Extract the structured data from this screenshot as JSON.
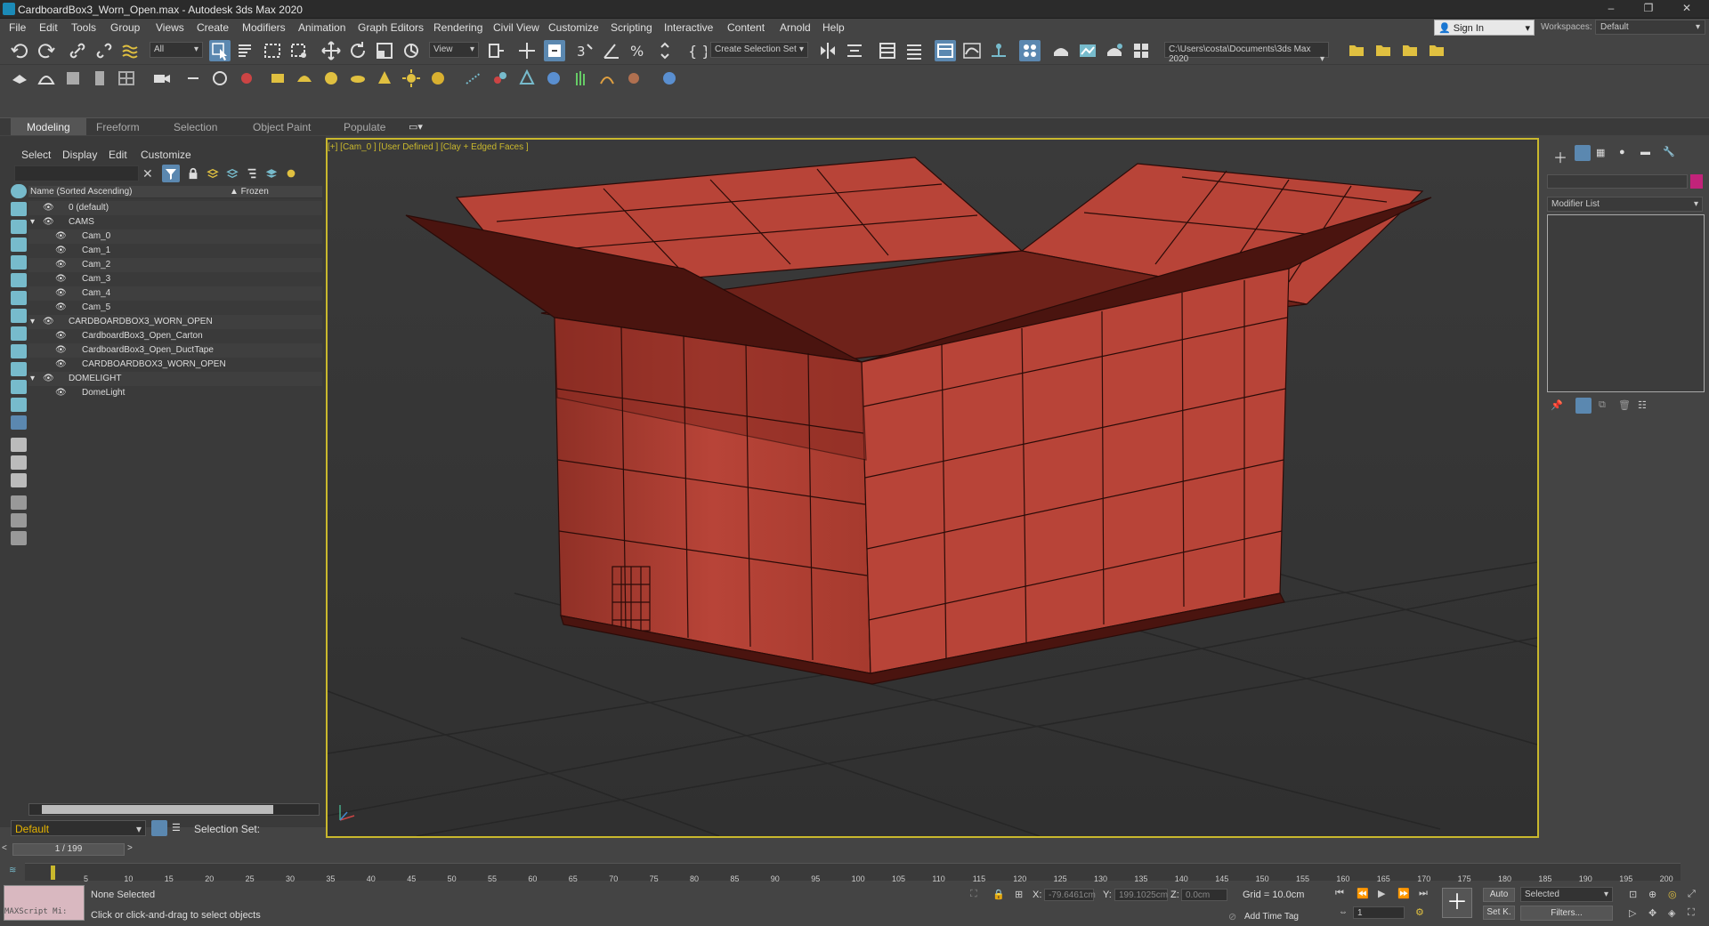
{
  "window": {
    "title": "CardboardBox3_Worn_Open.max - Autodesk 3ds Max 2020",
    "controls": {
      "minimize": "–",
      "maximize": "❐",
      "close": "✕"
    }
  },
  "menu": [
    "File",
    "Edit",
    "Tools",
    "Group",
    "Views",
    "Create",
    "Modifiers",
    "Animation",
    "Graph Editors",
    "Rendering",
    "Civil View",
    "Customize",
    "Scripting",
    "Interactive",
    "Content",
    "Arnold",
    "Help"
  ],
  "account": {
    "sign_in": "Sign In",
    "workspaces_label": "Workspaces:",
    "workspace": "Default"
  },
  "toolbar": {
    "selection_filter": "All",
    "ref_coord": "View",
    "create_selection_set": "Create Selection Set",
    "project_path": "C:\\Users\\costa\\Documents\\3ds Max 2020"
  },
  "ribbon_tabs": [
    "Modeling",
    "Freeform",
    "Selection",
    "Object Paint",
    "Populate"
  ],
  "scene_explorer": {
    "menus": [
      "Select",
      "Display",
      "Edit",
      "Customize"
    ],
    "col_name": "Name (Sorted Ascending)",
    "col_frozen": "▲ Frozen",
    "rows": [
      {
        "label": "0 (default)"
      },
      {
        "label": "CAMS"
      },
      {
        "label": "Cam_0"
      },
      {
        "label": "Cam_1"
      },
      {
        "label": "Cam_2"
      },
      {
        "label": "Cam_3"
      },
      {
        "label": "Cam_4"
      },
      {
        "label": "Cam_5"
      },
      {
        "label": "CARDBOARDBOX3_WORN_OPEN"
      },
      {
        "label": "CardboardBox3_Open_Carton"
      },
      {
        "label": "CardboardBox3_Open_DuctTape"
      },
      {
        "label": "CARDBOARDBOX3_WORN_OPEN"
      },
      {
        "label": "DOMELIGHT"
      },
      {
        "label": "DomeLight"
      }
    ],
    "layer": "Default",
    "selection_set_label": "Selection Set:"
  },
  "viewport": {
    "label": "[+] [Cam_0 ] [User Defined ] [Clay + Edged Faces ]"
  },
  "command_panel": {
    "modifier_list": "Modifier List"
  },
  "timeline": {
    "frame": "1 / 199",
    "ticks": [
      "5",
      "10",
      "15",
      "20",
      "25",
      "30",
      "35",
      "40",
      "45",
      "50",
      "55",
      "60",
      "65",
      "70",
      "75",
      "80",
      "85",
      "90",
      "95",
      "100",
      "105",
      "110",
      "115",
      "120",
      "125",
      "130",
      "135",
      "140",
      "145",
      "150",
      "155",
      "160",
      "165",
      "170",
      "175",
      "180",
      "185",
      "190",
      "195",
      "200"
    ]
  },
  "status": {
    "maxscript": "MAXScript Mi:",
    "selection": "None Selected",
    "prompt": "Click or click-and-drag to select objects",
    "x_label": "X:",
    "x_value": "-79.6461cm",
    "y_label": "Y:",
    "y_value": "199.1025cm",
    "z_label": "Z:",
    "z_value": "0.0cm",
    "grid": "Grid = 10.0cm",
    "add_time_tag": "Add Time Tag",
    "auto": "Auto",
    "selected": "Selected",
    "set_key": "Set K.",
    "filters": "Filters...",
    "key_frame": "1"
  },
  "colors": {
    "box": "#b84438",
    "viewport_border": "#c9b82d",
    "accent": "#5b88b0"
  }
}
